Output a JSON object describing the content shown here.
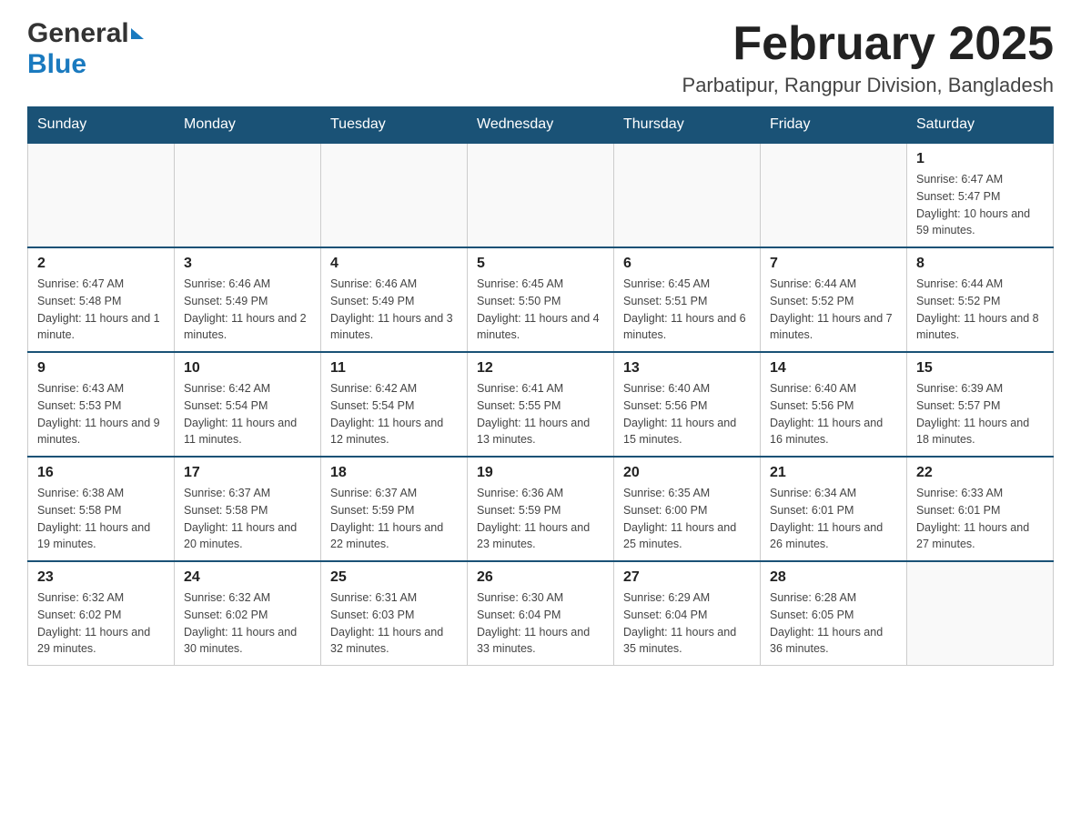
{
  "header": {
    "logo": {
      "general_text": "General",
      "blue_text": "Blue"
    },
    "title": "February 2025",
    "subtitle": "Parbatipur, Rangpur Division, Bangladesh"
  },
  "days_of_week": [
    "Sunday",
    "Monday",
    "Tuesday",
    "Wednesday",
    "Thursday",
    "Friday",
    "Saturday"
  ],
  "weeks": [
    [
      {
        "day": "",
        "info": ""
      },
      {
        "day": "",
        "info": ""
      },
      {
        "day": "",
        "info": ""
      },
      {
        "day": "",
        "info": ""
      },
      {
        "day": "",
        "info": ""
      },
      {
        "day": "",
        "info": ""
      },
      {
        "day": "1",
        "info": "Sunrise: 6:47 AM\nSunset: 5:47 PM\nDaylight: 10 hours and 59 minutes."
      }
    ],
    [
      {
        "day": "2",
        "info": "Sunrise: 6:47 AM\nSunset: 5:48 PM\nDaylight: 11 hours and 1 minute."
      },
      {
        "day": "3",
        "info": "Sunrise: 6:46 AM\nSunset: 5:49 PM\nDaylight: 11 hours and 2 minutes."
      },
      {
        "day": "4",
        "info": "Sunrise: 6:46 AM\nSunset: 5:49 PM\nDaylight: 11 hours and 3 minutes."
      },
      {
        "day": "5",
        "info": "Sunrise: 6:45 AM\nSunset: 5:50 PM\nDaylight: 11 hours and 4 minutes."
      },
      {
        "day": "6",
        "info": "Sunrise: 6:45 AM\nSunset: 5:51 PM\nDaylight: 11 hours and 6 minutes."
      },
      {
        "day": "7",
        "info": "Sunrise: 6:44 AM\nSunset: 5:52 PM\nDaylight: 11 hours and 7 minutes."
      },
      {
        "day": "8",
        "info": "Sunrise: 6:44 AM\nSunset: 5:52 PM\nDaylight: 11 hours and 8 minutes."
      }
    ],
    [
      {
        "day": "9",
        "info": "Sunrise: 6:43 AM\nSunset: 5:53 PM\nDaylight: 11 hours and 9 minutes."
      },
      {
        "day": "10",
        "info": "Sunrise: 6:42 AM\nSunset: 5:54 PM\nDaylight: 11 hours and 11 minutes."
      },
      {
        "day": "11",
        "info": "Sunrise: 6:42 AM\nSunset: 5:54 PM\nDaylight: 11 hours and 12 minutes."
      },
      {
        "day": "12",
        "info": "Sunrise: 6:41 AM\nSunset: 5:55 PM\nDaylight: 11 hours and 13 minutes."
      },
      {
        "day": "13",
        "info": "Sunrise: 6:40 AM\nSunset: 5:56 PM\nDaylight: 11 hours and 15 minutes."
      },
      {
        "day": "14",
        "info": "Sunrise: 6:40 AM\nSunset: 5:56 PM\nDaylight: 11 hours and 16 minutes."
      },
      {
        "day": "15",
        "info": "Sunrise: 6:39 AM\nSunset: 5:57 PM\nDaylight: 11 hours and 18 minutes."
      }
    ],
    [
      {
        "day": "16",
        "info": "Sunrise: 6:38 AM\nSunset: 5:58 PM\nDaylight: 11 hours and 19 minutes."
      },
      {
        "day": "17",
        "info": "Sunrise: 6:37 AM\nSunset: 5:58 PM\nDaylight: 11 hours and 20 minutes."
      },
      {
        "day": "18",
        "info": "Sunrise: 6:37 AM\nSunset: 5:59 PM\nDaylight: 11 hours and 22 minutes."
      },
      {
        "day": "19",
        "info": "Sunrise: 6:36 AM\nSunset: 5:59 PM\nDaylight: 11 hours and 23 minutes."
      },
      {
        "day": "20",
        "info": "Sunrise: 6:35 AM\nSunset: 6:00 PM\nDaylight: 11 hours and 25 minutes."
      },
      {
        "day": "21",
        "info": "Sunrise: 6:34 AM\nSunset: 6:01 PM\nDaylight: 11 hours and 26 minutes."
      },
      {
        "day": "22",
        "info": "Sunrise: 6:33 AM\nSunset: 6:01 PM\nDaylight: 11 hours and 27 minutes."
      }
    ],
    [
      {
        "day": "23",
        "info": "Sunrise: 6:32 AM\nSunset: 6:02 PM\nDaylight: 11 hours and 29 minutes."
      },
      {
        "day": "24",
        "info": "Sunrise: 6:32 AM\nSunset: 6:02 PM\nDaylight: 11 hours and 30 minutes."
      },
      {
        "day": "25",
        "info": "Sunrise: 6:31 AM\nSunset: 6:03 PM\nDaylight: 11 hours and 32 minutes."
      },
      {
        "day": "26",
        "info": "Sunrise: 6:30 AM\nSunset: 6:04 PM\nDaylight: 11 hours and 33 minutes."
      },
      {
        "day": "27",
        "info": "Sunrise: 6:29 AM\nSunset: 6:04 PM\nDaylight: 11 hours and 35 minutes."
      },
      {
        "day": "28",
        "info": "Sunrise: 6:28 AM\nSunset: 6:05 PM\nDaylight: 11 hours and 36 minutes."
      },
      {
        "day": "",
        "info": ""
      }
    ]
  ]
}
